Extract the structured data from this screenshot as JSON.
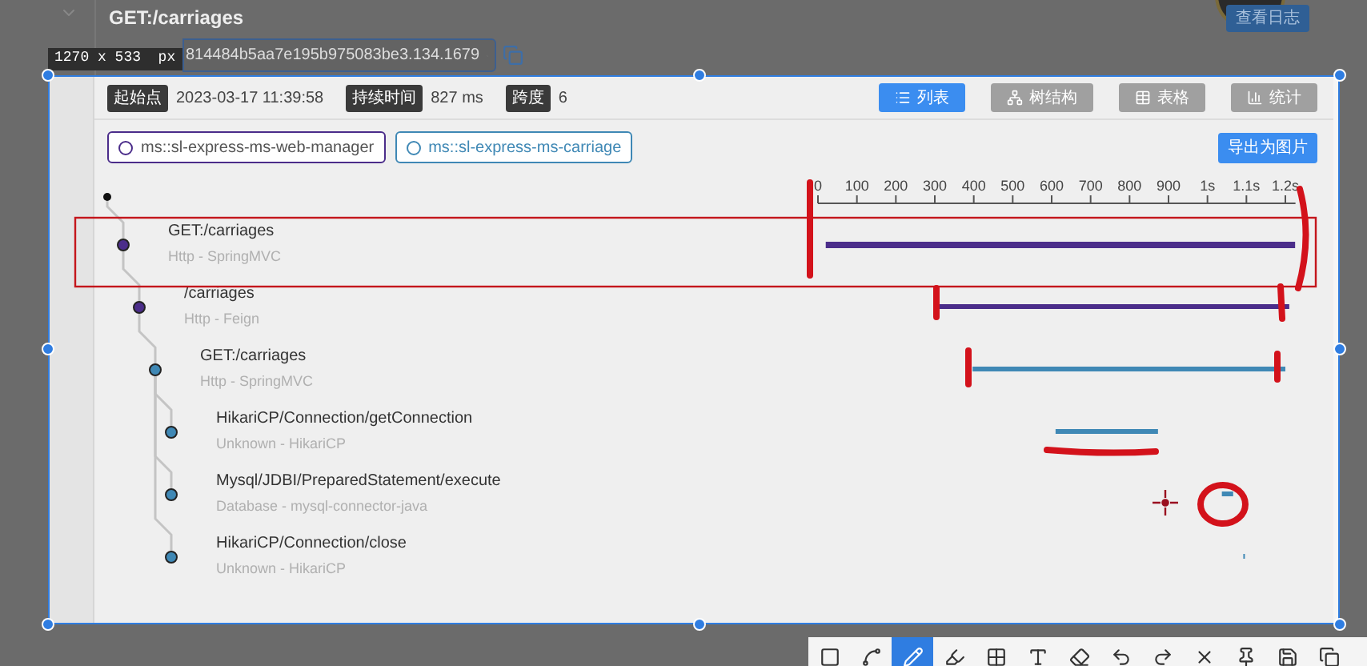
{
  "background_page": {
    "title": "GET:/carriages",
    "trace_id": "814484b5aa7e195b975083be3.134.1679",
    "log_button": "查看日志"
  },
  "capture": {
    "size_label": "1270 x 533  px"
  },
  "trace": {
    "meta": [
      {
        "label": "起始点",
        "value": "2023-03-17 11:39:58"
      },
      {
        "label": "持续时间",
        "value": "827 ms"
      },
      {
        "label": "跨度",
        "value": "6"
      }
    ],
    "view_tabs": [
      {
        "label": "列表",
        "kind": "list",
        "selected": true
      },
      {
        "label": "树结构",
        "kind": "tree",
        "selected": false
      },
      {
        "label": "表格",
        "kind": "table",
        "selected": false
      },
      {
        "label": "统计",
        "kind": "stats",
        "selected": false
      }
    ],
    "services": [
      {
        "name": "ms::sl-express-ms-web-manager",
        "color": "#4b2d8a"
      },
      {
        "name": "ms::sl-express-ms-carriage",
        "color": "#3f88b5"
      }
    ],
    "export_button": "导出为图片",
    "spans": [
      {
        "name": "GET:/carriages",
        "type": "Http - SpringMVC",
        "color": "#4b2d8a",
        "children": [
          {
            "name": "/carriages",
            "type": "Http - Feign",
            "color": "#4b2d8a",
            "children": [
              {
                "name": "GET:/carriages",
                "type": "Http - SpringMVC",
                "color": "#3f88b5",
                "children": [
                  {
                    "name": "HikariCP/Connection/getConnection",
                    "type": "Unknown - HikariCP",
                    "color": "#3f88b5"
                  },
                  {
                    "name": "Mysql/JDBI/PreparedStatement/execute",
                    "type": "Database - mysql-connector-java",
                    "color": "#3f88b5"
                  },
                  {
                    "name": "HikariCP/Connection/close",
                    "type": "Unknown - HikariCP",
                    "color": "#3f88b5"
                  }
                ]
              }
            ]
          }
        ]
      }
    ],
    "timeline_ticks": [
      "0",
      "100",
      "200",
      "300",
      "400",
      "500",
      "600",
      "700",
      "800",
      "900",
      "1s",
      "1.1s",
      "1.2s"
    ]
  },
  "toolbar": [
    {
      "kind": "shape",
      "selected": false
    },
    {
      "kind": "line",
      "selected": false
    },
    {
      "kind": "pen",
      "selected": true
    },
    {
      "kind": "marker",
      "selected": false
    },
    {
      "kind": "mosaic",
      "selected": false
    },
    {
      "kind": "text",
      "selected": false
    },
    {
      "kind": "eraser",
      "selected": false
    },
    {
      "kind": "undo",
      "selected": false
    },
    {
      "kind": "redo",
      "selected": false
    },
    {
      "kind": "close",
      "selected": false
    },
    {
      "kind": "pin",
      "selected": false
    },
    {
      "kind": "save",
      "selected": false
    },
    {
      "kind": "copy",
      "selected": false
    }
  ]
}
